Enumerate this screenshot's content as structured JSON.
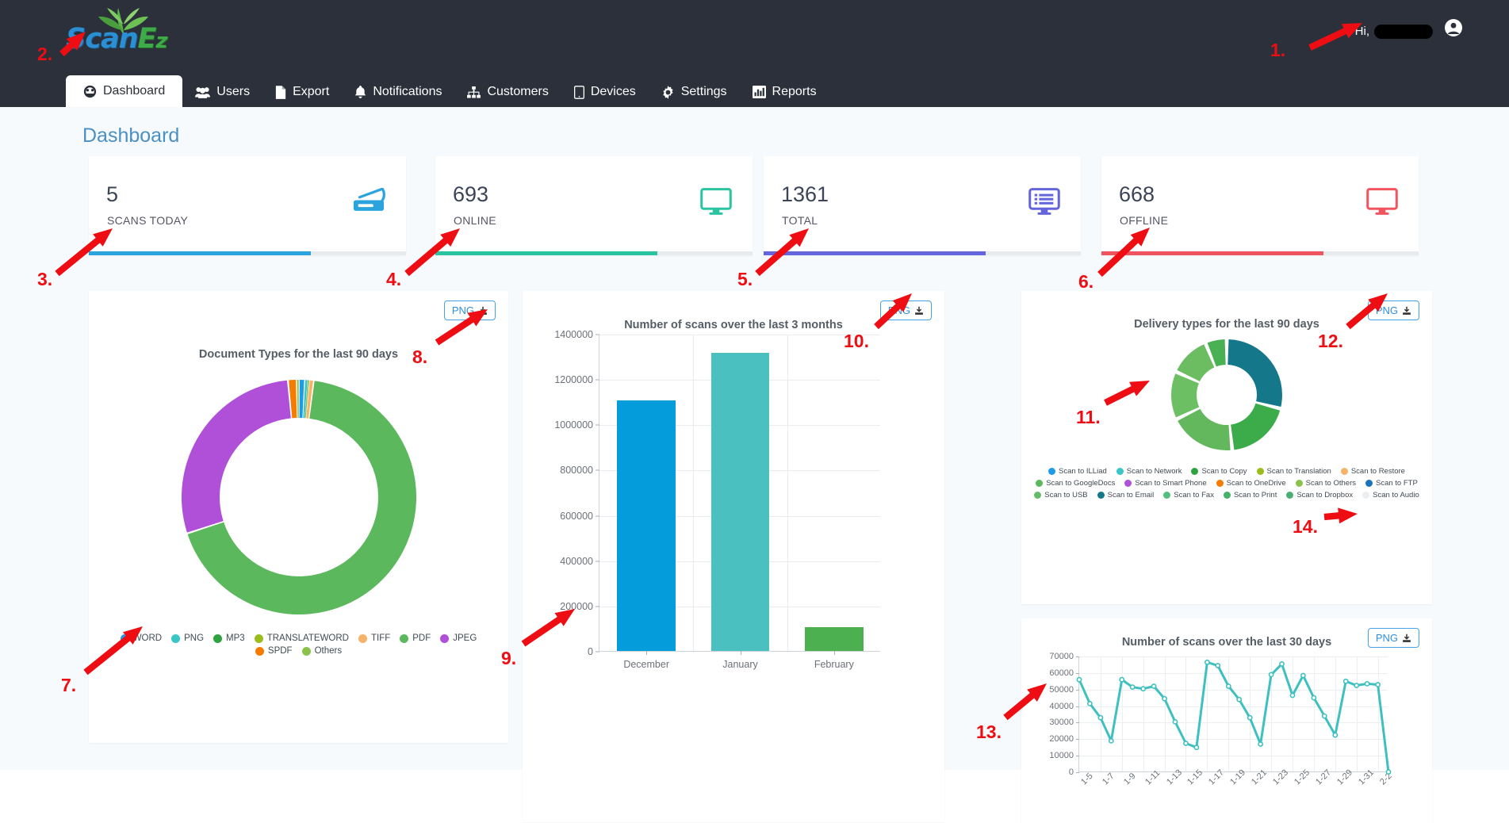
{
  "app": {
    "logo_scan": "Scan",
    "logo_e": "E",
    "logo_z": "z",
    "greeting": "Hi,"
  },
  "nav": {
    "items": [
      {
        "label": "Dashboard",
        "icon": "dashboard-icon",
        "active": true
      },
      {
        "label": "Users",
        "icon": "users-icon",
        "active": false
      },
      {
        "label": "Export",
        "icon": "file-icon",
        "active": false
      },
      {
        "label": "Notifications",
        "icon": "bell-icon",
        "active": false
      },
      {
        "label": "Customers",
        "icon": "sitemap-icon",
        "active": false
      },
      {
        "label": "Devices",
        "icon": "tablet-icon",
        "active": false
      },
      {
        "label": "Settings",
        "icon": "gear-icon",
        "active": false
      },
      {
        "label": "Reports",
        "icon": "bar-chart-icon",
        "active": false
      }
    ]
  },
  "page": {
    "title": "Dashboard"
  },
  "stats": [
    {
      "value": "5",
      "label": "SCANS TODAY",
      "color": "#2ba3dd",
      "icon": "scanner-icon",
      "progress": 70
    },
    {
      "value": "693",
      "label": "ONLINE",
      "color": "#2ac5a0",
      "icon": "monitor-icon",
      "progress": 70
    },
    {
      "value": "1361",
      "label": "TOTAL",
      "color": "#6464dc",
      "icon": "device-list-icon",
      "progress": 70
    },
    {
      "value": "668",
      "label": "OFFLINE",
      "color": "#f0555f",
      "icon": "monitor-icon",
      "progress": 70
    }
  ],
  "download_button": {
    "label": "PNG",
    "icon": "download-icon"
  },
  "chart_data": [
    {
      "id": "document-types",
      "type": "pie",
      "title": "Document Types for the last 90 days",
      "legend_position": "bottom",
      "categories": [
        "WORD",
        "PNG",
        "MP3",
        "TRANSLATEWORD",
        "TIFF",
        "PDF",
        "JPEG",
        "SPDF",
        "Others"
      ],
      "colors": [
        "#1e9ae8",
        "#38c6c6",
        "#2fa33f",
        "#9bbd1c",
        "#f7b36a",
        "#5cb85c",
        "#b04fd8",
        "#f57c00",
        "#8bc34a"
      ],
      "values": [
        0.8,
        0.4,
        0.1,
        0.1,
        0.6,
        68.0,
        28.5,
        1.2,
        0.3
      ],
      "value_unit": "percent"
    },
    {
      "id": "scans-3-months",
      "type": "bar",
      "title": "Number of scans over the last 3 months",
      "categories": [
        "December",
        "January",
        "February"
      ],
      "values": [
        1105000,
        1315000,
        105000
      ],
      "colors": [
        "#049cdb",
        "#4bc0c0",
        "#4caf50"
      ],
      "ylabel": "",
      "xlabel": "",
      "ylim": [
        0,
        1400000
      ],
      "yticks": [
        0,
        200000,
        400000,
        600000,
        800000,
        1000000,
        1200000,
        1400000
      ],
      "ytick_labels": [
        "0",
        "200000",
        "400000",
        "600000",
        "800000",
        "1000000",
        "1200000",
        "1400000"
      ],
      "grid": true
    },
    {
      "id": "delivery-types",
      "type": "pie",
      "title": "Delivery types for the last 90 days",
      "legend_position": "bottom",
      "categories": [
        "Scan to ILLiad",
        "Scan to Network",
        "Scan to Copy",
        "Scan to Translation",
        "Scan to Restore",
        "Scan to GoogleDocs",
        "Scan to Smart Phone",
        "Scan to OneDrive",
        "Scan to Others",
        "Scan to FTP",
        "Scan to USB",
        "Scan to Email",
        "Scan to Fax",
        "Scan to Print",
        "Scan to Dropbox",
        "Scan to Audio"
      ],
      "colors": [
        "#1e9ae8",
        "#38c6c6",
        "#2fa33f",
        "#9bbd1c",
        "#f7b36a",
        "#5cb85c",
        "#b04fd8",
        "#f57c00",
        "#8bc34a",
        "#1a73b8",
        "#66bb6a",
        "#15788a",
        "#53bf7f",
        "#45b26b",
        "#4caf72",
        "#eceff1"
      ],
      "slices": [
        {
          "label": "Scan to Email",
          "value": 29.0,
          "color": "#15788a"
        },
        {
          "label": "Scan to Copy",
          "value": 19.4,
          "color": "#3cab4a"
        },
        {
          "label": "Scan to Print",
          "value": 19.4,
          "color": "#63b85e"
        },
        {
          "label": "Scan to Others",
          "value": 14.0,
          "color": "#6cbf63"
        },
        {
          "label": "Scan to Dropbox",
          "value": 12.0,
          "color": "#6cbd62"
        },
        {
          "label": "Scan to Fax",
          "value": 6.2,
          "color": "#49b054"
        }
      ]
    },
    {
      "id": "scans-30-days",
      "type": "line",
      "title": "Number of scans over the last 30 days",
      "ylim": [
        0,
        70000
      ],
      "yticks": [
        0,
        10000,
        20000,
        30000,
        40000,
        50000,
        60000,
        70000
      ],
      "ytick_labels": [
        "0",
        "10000",
        "20000",
        "30000",
        "40000",
        "50000",
        "60000",
        "70000"
      ],
      "xtick_labels": [
        "1-5",
        "1-7",
        "1-9",
        "1-11",
        "1-13",
        "1-15",
        "1-17",
        "1-19",
        "1-21",
        "1-23",
        "1-25",
        "1-27",
        "1-29",
        "1-31",
        "2-2"
      ],
      "x": [
        "1-5",
        "1-6",
        "1-7",
        "1-8",
        "1-9",
        "1-10",
        "1-11",
        "1-12",
        "1-13",
        "1-14",
        "1-15",
        "1-16",
        "1-17",
        "1-18",
        "1-19",
        "1-20",
        "1-21",
        "1-22",
        "1-23",
        "1-24",
        "1-25",
        "1-26",
        "1-27",
        "1-28",
        "1-29",
        "1-30",
        "1-31",
        "2-1",
        "2-2",
        "2-3"
      ],
      "values": [
        56000,
        41500,
        33000,
        19000,
        56000,
        51500,
        50500,
        52000,
        44500,
        30500,
        17500,
        15000,
        66500,
        64500,
        52000,
        44000,
        33000,
        17000,
        59000,
        65500,
        46500,
        58500,
        45000,
        34000,
        22500,
        55000,
        52500,
        53500,
        53000,
        200
      ],
      "color": "#3fc0c0",
      "grid": true
    }
  ],
  "annotations": [
    {
      "num": "1.",
      "target": "greeting"
    },
    {
      "num": "2.",
      "target": "logo"
    },
    {
      "num": "3.",
      "target": "stat-scans-today"
    },
    {
      "num": "4.",
      "target": "stat-online"
    },
    {
      "num": "5.",
      "target": "stat-total"
    },
    {
      "num": "6.",
      "target": "stat-offline"
    },
    {
      "num": "7.",
      "target": "document-types-legend"
    },
    {
      "num": "8.",
      "target": "document-types-png-button"
    },
    {
      "num": "9.",
      "target": "bar-chart-axis"
    },
    {
      "num": "10.",
      "target": "bar-chart-png-button"
    },
    {
      "num": "11.",
      "target": "delivery-types-donut"
    },
    {
      "num": "12.",
      "target": "delivery-types-png-button"
    },
    {
      "num": "13.",
      "target": "line-chart-axis"
    },
    {
      "num": "14.",
      "target": "line-chart-png-button"
    }
  ]
}
